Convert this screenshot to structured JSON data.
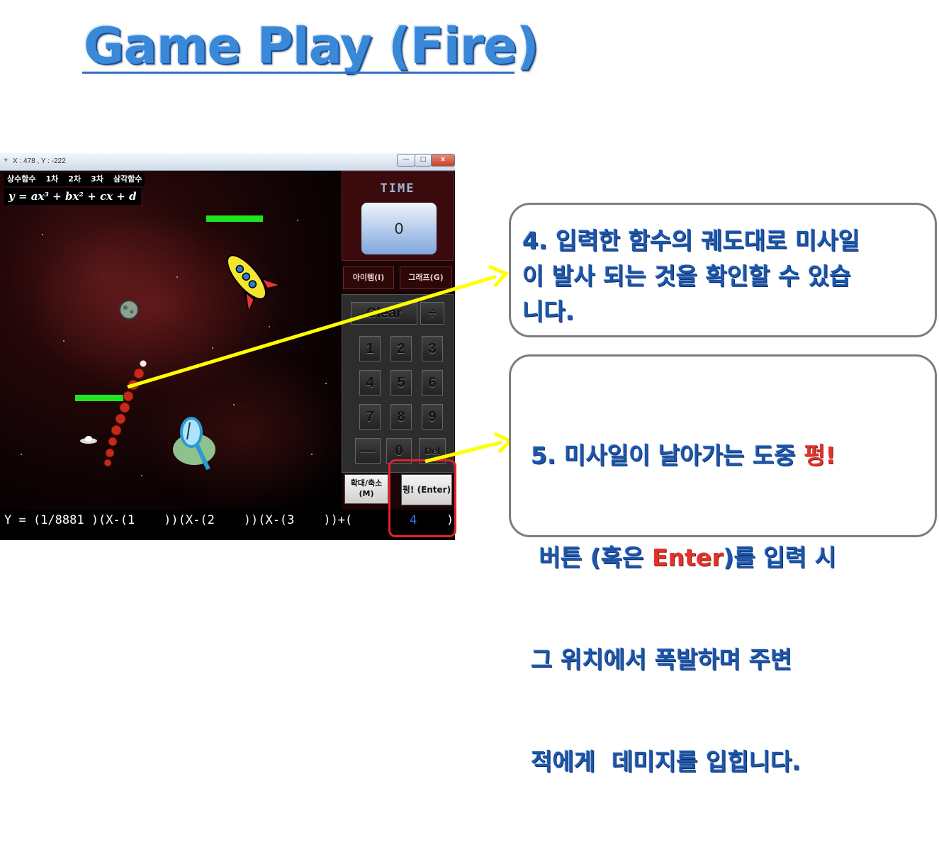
{
  "slide": {
    "title": "Game Play (Fire)"
  },
  "window": {
    "title": "X : 478 , Y : -222",
    "buttons": {
      "minimize": "—",
      "maximize": "□",
      "close": "x"
    }
  },
  "game": {
    "menu": [
      "상수함수",
      "1차",
      "2차",
      "3차",
      "삼각함수"
    ],
    "formula": "y = ax³ + bx² + cx + d"
  },
  "side": {
    "time_label": "TIME",
    "time_value": "0",
    "item_button": "아이템(I)",
    "graph_button": "그래프(G)",
    "keys": {
      "clear": "Clear",
      "divide": "÷",
      "k1": "1",
      "k2": "2",
      "k3": "3",
      "k4": "4",
      "k5": "5",
      "k6": "6",
      "k7": "7",
      "k8": "8",
      "k9": "9",
      "minus": "—",
      "k0": "0",
      "del": "Del"
    },
    "zoom_button": "확대/축소\n(M)",
    "fire_button": "펑! (Enter)"
  },
  "equation": {
    "prefix": "Y = (1/8881 )(X-(1    ))(X-(2    ))(X-(3    ))+(",
    "value": "4",
    "suffix": ")"
  },
  "callouts": {
    "step4": [
      "4. 입력한 함수의 궤도대로 미사일",
      "이 발사 되는 것을 확인할 수 있습",
      "니다."
    ],
    "step5": {
      "line1_a": "5. 미사일이 날아가는 도중 ",
      "line1_red": "펑!",
      "line2_a": " 버튼 (혹은 ",
      "line2_red": "Enter",
      "line2_b": ")를 입력 시",
      "line3": "그 위치에서 폭발하며 주변",
      "line4": "적에게  데미지를 입힙니다."
    }
  },
  "colors": {
    "title": "#3a88d8",
    "callout_text": "#1d56a8",
    "highlight": "#e4212b",
    "arrow": "#ffff00",
    "green_bar": "#1ee61e"
  }
}
